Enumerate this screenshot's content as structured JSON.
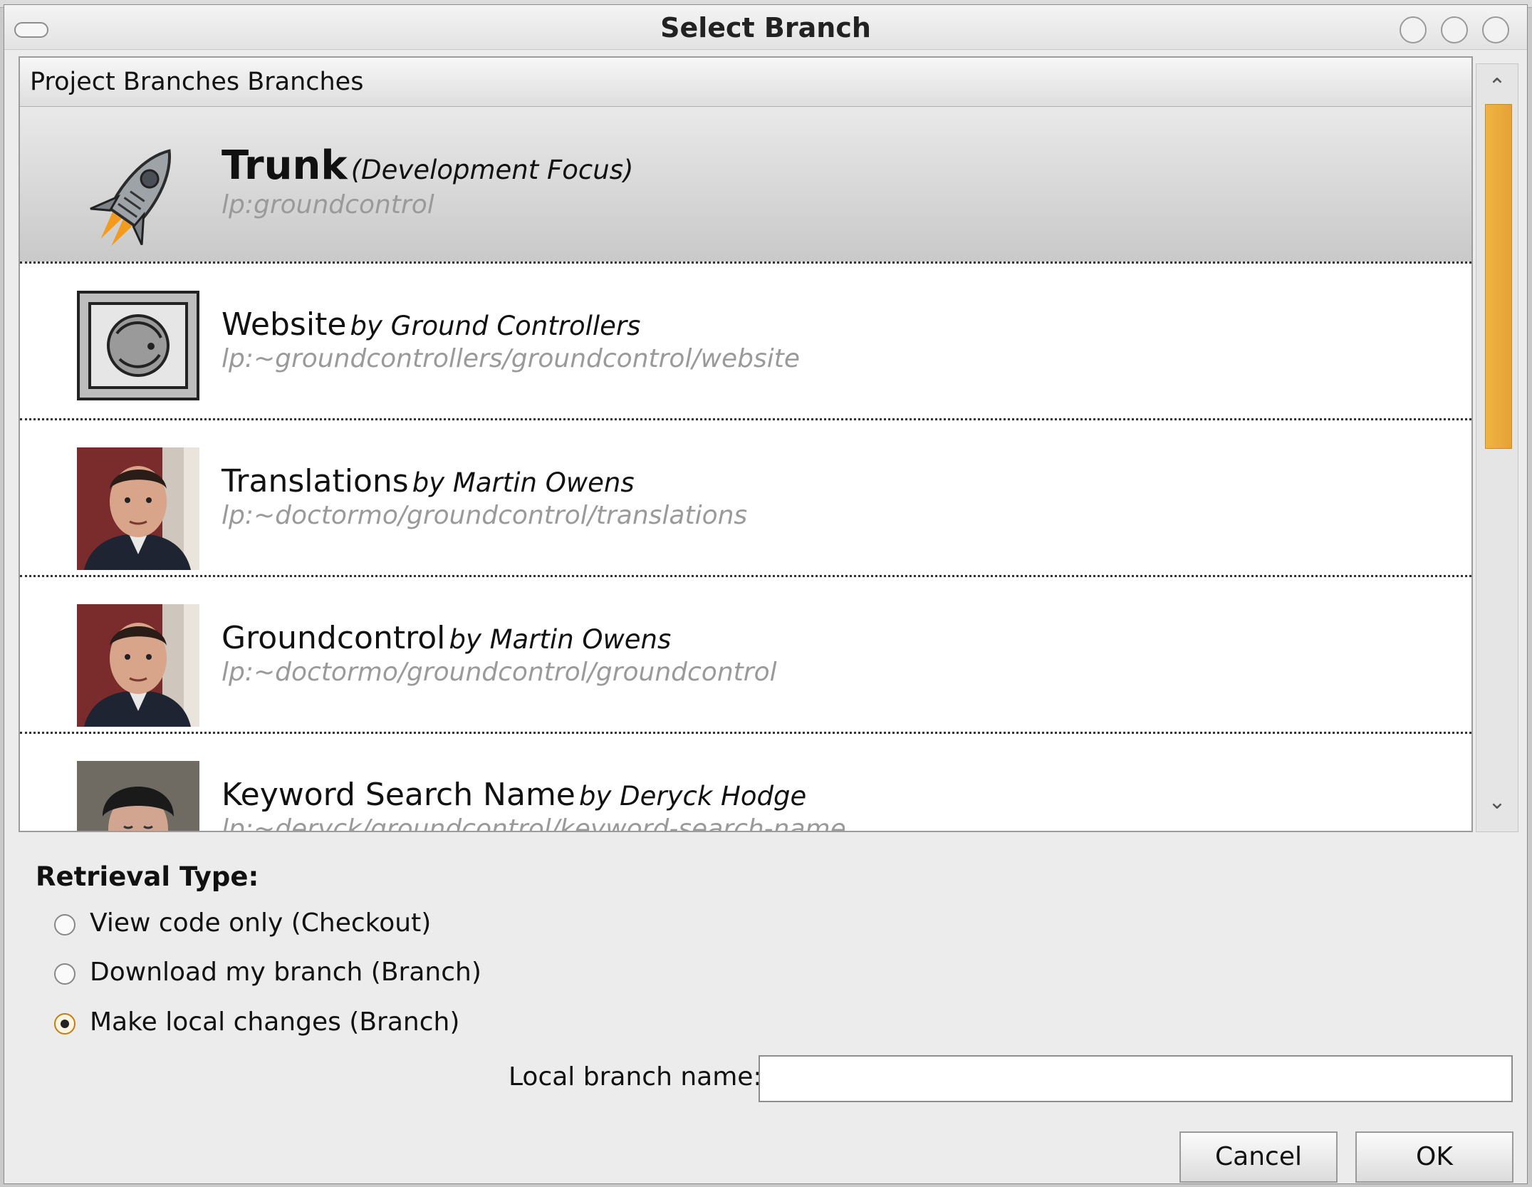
{
  "window": {
    "title": "Select Branch"
  },
  "list": {
    "header": "Project Branches Branches",
    "rows": [
      {
        "name": "Trunk",
        "by": "(Development Focus)",
        "url": "lp:groundcontrol",
        "icon": "rocket-icon",
        "selected": true
      },
      {
        "name": "Website",
        "by": "by Ground Controllers",
        "url": "lp:~groundcontrollers/groundcontrol/website",
        "icon": "team-logo-icon",
        "selected": false
      },
      {
        "name": "Translations",
        "by": "by Martin Owens",
        "url": "lp:~doctormo/groundcontrol/translations",
        "icon": "avatar-martin",
        "selected": false
      },
      {
        "name": "Groundcontrol",
        "by": "by Martin Owens",
        "url": "lp:~doctormo/groundcontrol/groundcontrol",
        "icon": "avatar-martin",
        "selected": false
      },
      {
        "name": "Keyword Search Name",
        "by": "by Deryck Hodge",
        "url": "lp:~deryck/groundcontrol/keyword-search-name",
        "icon": "avatar-deryck",
        "selected": false
      }
    ]
  },
  "retrieval": {
    "label": "Retrieval Type:",
    "options": [
      {
        "label": "View code only (Checkout)",
        "checked": false
      },
      {
        "label": "Download my branch (Branch)",
        "checked": false
      },
      {
        "label": "Make local changes (Branch)",
        "checked": true
      }
    ],
    "local_branch_label": "Local branch name:",
    "local_branch_value": ""
  },
  "buttons": {
    "cancel": "Cancel",
    "ok": "OK"
  },
  "colors": {
    "scroll_thumb": "#f0b443",
    "selected_row": "#d6d6d6"
  }
}
